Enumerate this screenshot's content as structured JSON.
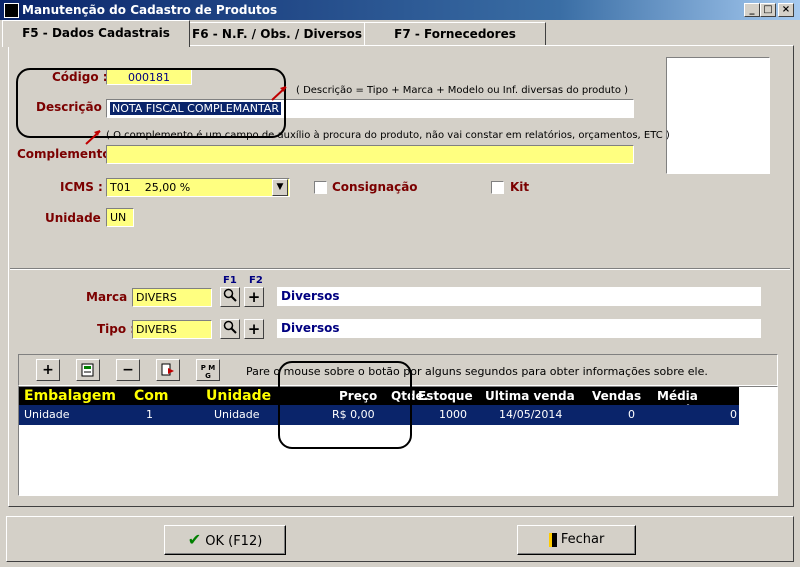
{
  "window": {
    "title": "Manutenção do Cadastro de Produtos",
    "controls": [
      "_",
      "□",
      "×"
    ]
  },
  "tabs": [
    {
      "label": "F5 - Dados Cadastrais"
    },
    {
      "label": "F6 - N.F. / Obs. / Diversos"
    },
    {
      "label": "F7 - Fornecedores"
    }
  ],
  "form": {
    "codigo_label": "Código :",
    "codigo_value": "000181",
    "descricao_hint": "( Descrição = Tipo + Marca + Modelo ou Inf. diversas do produto )",
    "descricao_label": "Descrição :",
    "descricao_value": "NOTA FISCAL COMPLEMANTAR",
    "complemento_hint": "( O complemento é um campo de auxílio à procura do produto, não vai constar em relatórios, orçamentos, ETC )",
    "complemento_label": "Complemento :",
    "complemento_value": "",
    "icms_label": "ICMS :",
    "icms_value": "T01    25,00 %",
    "consignacao_label": "Consignação",
    "kit_label": "Kit",
    "unidade_label": "Unidade :",
    "unidade_value": "UN"
  },
  "lookup": {
    "f1": "F1",
    "f2": "F2",
    "marca_label": "Marca :",
    "marca_value": "DIVERS",
    "marca_desc": "Diversos",
    "tipo_label": "Tipo :",
    "tipo_value": "DIVERS",
    "tipo_desc": "Diversos"
  },
  "toolbar": {
    "hint": "Pare o mouse sobre o botão por alguns segundos para obter informações sobre ele.",
    "buttons": [
      "add-icon",
      "edit-icon",
      "remove-icon",
      "export-icon",
      "pmg-icon"
    ],
    "pmg_text": "P M G"
  },
  "table": {
    "headers": [
      "Embalagem",
      "Com",
      "Unidade",
      "Preço",
      "Qtde.",
      "Estoque",
      "Ultima venda",
      "Vendas",
      "Média vendas"
    ],
    "rows": [
      [
        "Unidade",
        "1",
        "Unidade",
        "R$ 0,00",
        "",
        "1000",
        "14/05/2014",
        "0",
        "0"
      ]
    ]
  },
  "footer": {
    "ok_label": "OK (F12)",
    "close_label": "Fechar"
  },
  "colors": {
    "field": "#ffff80",
    "label": "#7b0000",
    "selection": "#0a246a",
    "desc_text": "#000080"
  }
}
